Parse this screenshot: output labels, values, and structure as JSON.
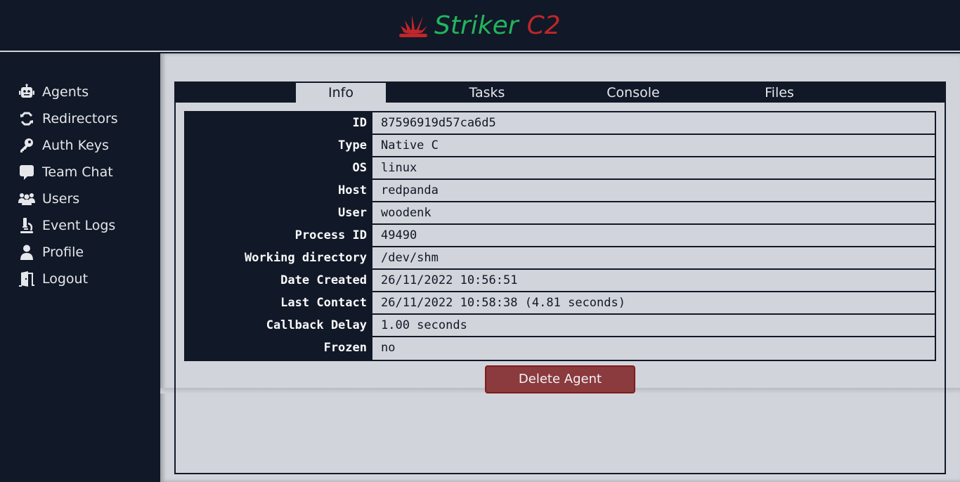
{
  "brand": {
    "word1": "Striker",
    "word2": "C2",
    "primary_color": "#22b55e",
    "secondary_color": "#c0262b"
  },
  "sidebar": {
    "items": [
      {
        "label": "Agents",
        "icon": "robot-icon"
      },
      {
        "label": "Redirectors",
        "icon": "recycle-icon"
      },
      {
        "label": "Auth Keys",
        "icon": "key-icon"
      },
      {
        "label": "Team Chat",
        "icon": "chat-bubble-icon"
      },
      {
        "label": "Users",
        "icon": "users-icon"
      },
      {
        "label": "Event Logs",
        "icon": "microscope-icon"
      },
      {
        "label": "Profile",
        "icon": "person-icon"
      },
      {
        "label": "Logout",
        "icon": "door-icon"
      }
    ]
  },
  "tabs": [
    {
      "label": "Info",
      "active": true
    },
    {
      "label": "Tasks",
      "active": false
    },
    {
      "label": "Console",
      "active": false
    },
    {
      "label": "Files",
      "active": false
    }
  ],
  "agent_info": [
    {
      "key": "ID",
      "value": "87596919d57ca6d5"
    },
    {
      "key": "Type",
      "value": "Native C"
    },
    {
      "key": "OS",
      "value": "linux"
    },
    {
      "key": "Host",
      "value": "redpanda"
    },
    {
      "key": "User",
      "value": "woodenk"
    },
    {
      "key": "Process ID",
      "value": "49490"
    },
    {
      "key": "Working directory",
      "value": "/dev/shm"
    },
    {
      "key": "Date Created",
      "value": "26/11/2022 10:56:51"
    },
    {
      "key": "Last Contact",
      "value": "26/11/2022 10:58:38 (4.81 seconds)"
    },
    {
      "key": "Callback Delay",
      "value": "1.00 seconds"
    },
    {
      "key": "Frozen",
      "value": "no"
    }
  ],
  "actions": {
    "delete_label": "Delete Agent"
  }
}
